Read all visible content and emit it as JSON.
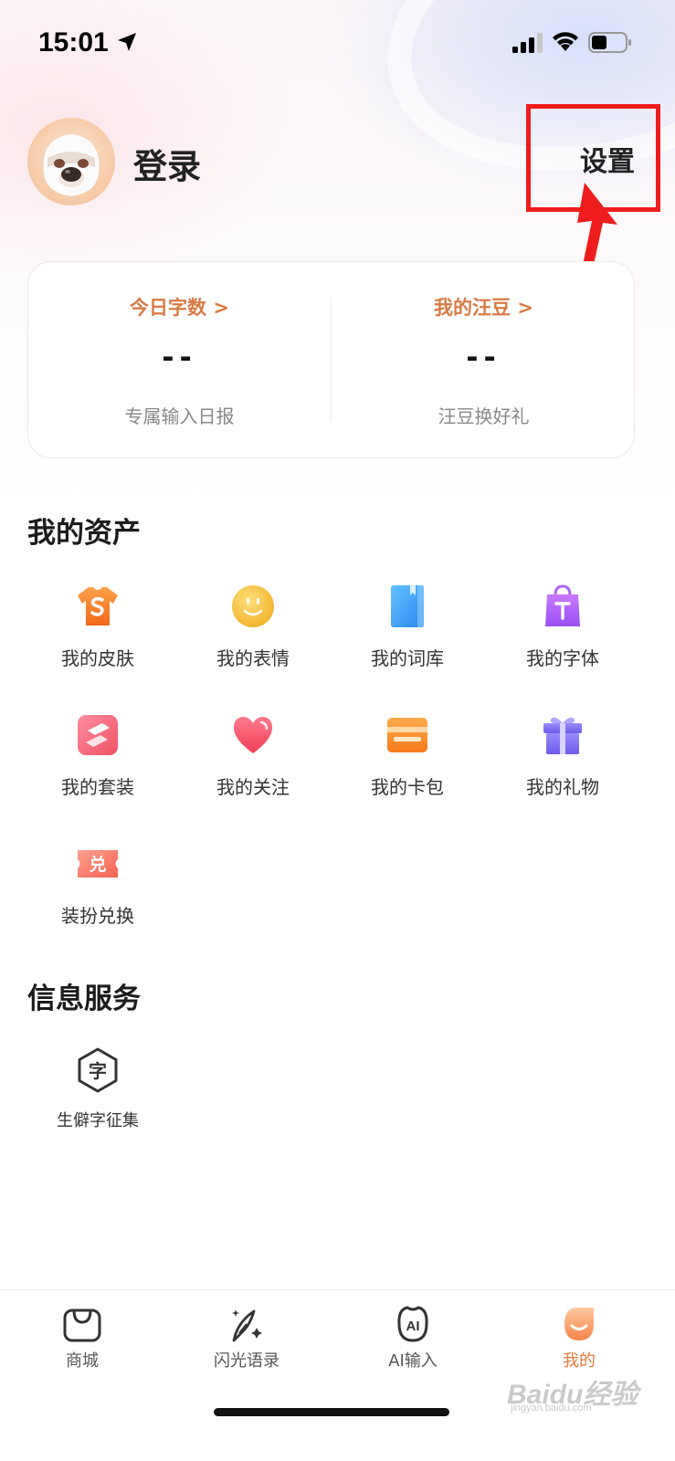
{
  "status_bar": {
    "time": "15:01"
  },
  "profile": {
    "login_label": "登录",
    "settings_label": "设置"
  },
  "stats": {
    "left": {
      "title": "今日字数 >",
      "value": "--",
      "subtitle": "专属输入日报"
    },
    "right": {
      "title": "我的汪豆 >",
      "value": "--",
      "subtitle": "汪豆换好礼"
    }
  },
  "assets": {
    "title": "我的资产",
    "items": [
      {
        "label": "我的皮肤",
        "icon": "shirt-icon"
      },
      {
        "label": "我的表情",
        "icon": "smiley-icon"
      },
      {
        "label": "我的词库",
        "icon": "book-icon"
      },
      {
        "label": "我的字体",
        "icon": "bag-icon"
      },
      {
        "label": "我的套装",
        "icon": "suit-icon"
      },
      {
        "label": "我的关注",
        "icon": "heart-icon"
      },
      {
        "label": "我的卡包",
        "icon": "wallet-icon"
      },
      {
        "label": "我的礼物",
        "icon": "gift-icon"
      },
      {
        "label": "装扮兑换",
        "icon": "redeem-icon",
        "glyph": "兑"
      }
    ]
  },
  "services": {
    "title": "信息服务",
    "items": [
      {
        "label": "生僻字征集",
        "icon": "rare-char-icon",
        "glyph": "字"
      }
    ]
  },
  "bottom_nav": {
    "items": [
      {
        "label": "商城",
        "icon": "shop-icon",
        "active": false
      },
      {
        "label": "闪光语录",
        "icon": "quill-icon",
        "active": false
      },
      {
        "label": "AI输入",
        "icon": "ai-icon",
        "glyph": "AI",
        "active": false
      },
      {
        "label": "我的",
        "icon": "mine-icon",
        "active": true
      }
    ]
  },
  "watermark": {
    "brand": "Baidu经验",
    "site": "jingyan.baidu.com"
  },
  "colors": {
    "accent": "#ea7b3f",
    "annotation": "#ee1c1c",
    "stat_title": "#d97a45"
  }
}
